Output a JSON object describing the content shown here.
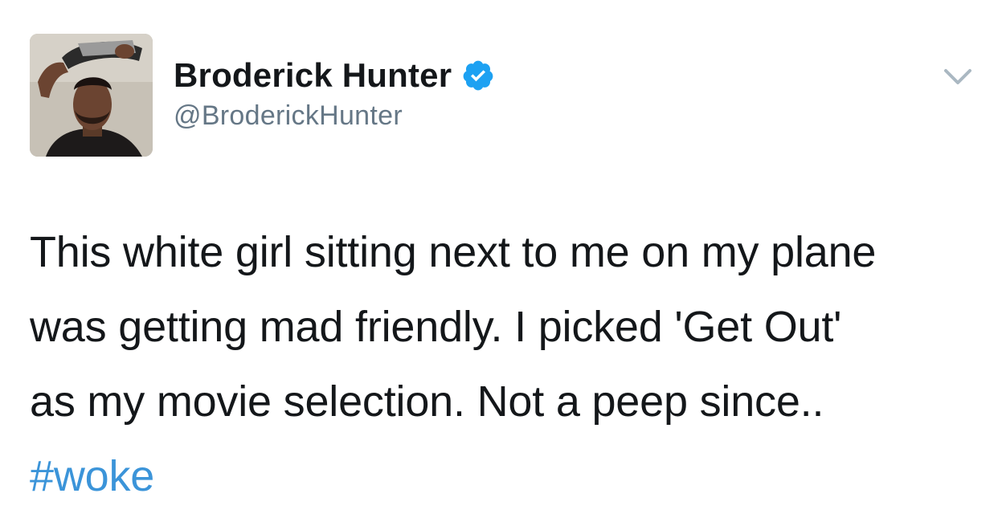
{
  "author": {
    "display_name": "Broderick Hunter",
    "handle": "@BroderickHunter",
    "verified": true,
    "avatar_icon": "profile-photo"
  },
  "menu": {
    "icon": "chevron-down-icon"
  },
  "tweet": {
    "lines": [
      "This white girl sitting next to me on my plane",
      "was getting mad friendly. I picked 'Get Out'",
      "as my movie selection. Not a peep since.."
    ],
    "hashtag": "#woke"
  },
  "colors": {
    "text": "#14171a",
    "handle": "#657786",
    "hashtag": "#3b94d9",
    "verified": "#1da1f2",
    "chevron": "#aab8c2"
  }
}
